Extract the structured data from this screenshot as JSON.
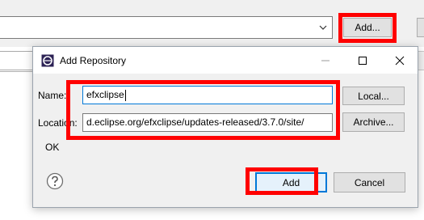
{
  "background": {
    "add_button_label": "Add...",
    "combo_chevron_icon": "chevron-down-icon"
  },
  "dialog": {
    "title": "Add Repository",
    "title_icon": "eclipse-icon",
    "controls": {
      "minimize": "minimize-icon",
      "maximize": "maximize-icon",
      "close": "close-icon"
    },
    "name_label": "Name:",
    "name_value": "efxclipse",
    "location_label": "Location:",
    "location_value": "d.eclipse.org/efxclipse/updates-released/3.7.0/site/",
    "local_button": "Local...",
    "archive_button": "Archive...",
    "status_text": "OK",
    "help_icon": "help-icon",
    "add_button": "Add",
    "cancel_button": "Cancel"
  },
  "colors": {
    "highlight": "#ff0000",
    "focus_accent": "#0078d7"
  }
}
